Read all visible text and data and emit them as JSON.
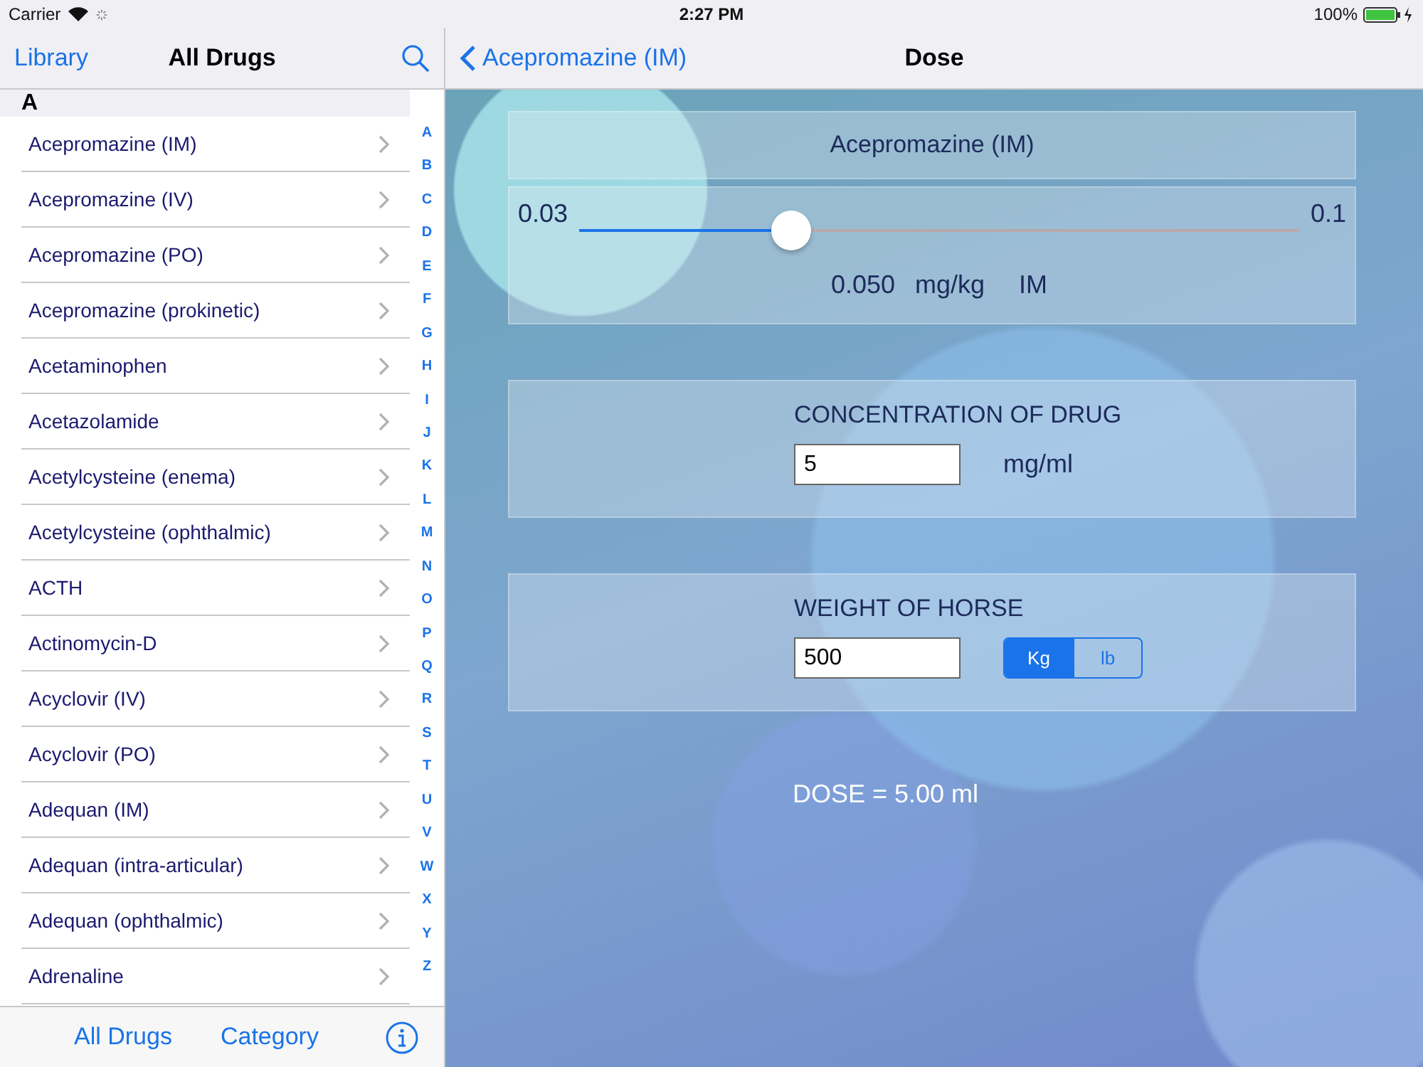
{
  "status_bar": {
    "carrier": "Carrier",
    "time": "2:27 PM",
    "battery": "100%"
  },
  "library": {
    "back": "Library",
    "title": "All Drugs",
    "section": "A",
    "items": [
      "Acepromazine (IM)",
      "Acepromazine (IV)",
      "Acepromazine (PO)",
      "Acepromazine (prokinetic)",
      "Acetaminophen",
      "Acetazolamide",
      "Acetylcysteine (enema)",
      "Acetylcysteine (ophthalmic)",
      "ACTH",
      "Actinomycin-D",
      "Acyclovir (IV)",
      "Acyclovir (PO)",
      "Adequan (IM)",
      "Adequan (intra-articular)",
      "Adequan (ophthalmic)",
      "Adrenaline"
    ],
    "index": [
      "A",
      "B",
      "C",
      "D",
      "E",
      "F",
      "G",
      "H",
      "I",
      "J",
      "K",
      "L",
      "M",
      "N",
      "O",
      "P",
      "Q",
      "R",
      "S",
      "T",
      "U",
      "V",
      "W",
      "X",
      "Y",
      "Z"
    ],
    "toolbar": [
      "All Drugs",
      "Category"
    ]
  },
  "detail": {
    "back": "Acepromazine (IM)",
    "title": "Dose",
    "drug": "Acepromazine (IM)",
    "slider": {
      "min": "0.03",
      "max": "0.1",
      "level": 0.295,
      "value": "0.050",
      "unit": "mg/kg",
      "route": "IM"
    },
    "concentration": {
      "label": "CONCENTRATION OF DRUG",
      "value": "5",
      "unit": "mg/ml"
    },
    "weight": {
      "label": "WEIGHT OF HORSE",
      "value": "500",
      "units": [
        {
          "label": "Kg",
          "selected": true
        },
        {
          "label": "lb",
          "selected": false
        }
      ]
    },
    "result": "DOSE = 5.00 ml"
  }
}
